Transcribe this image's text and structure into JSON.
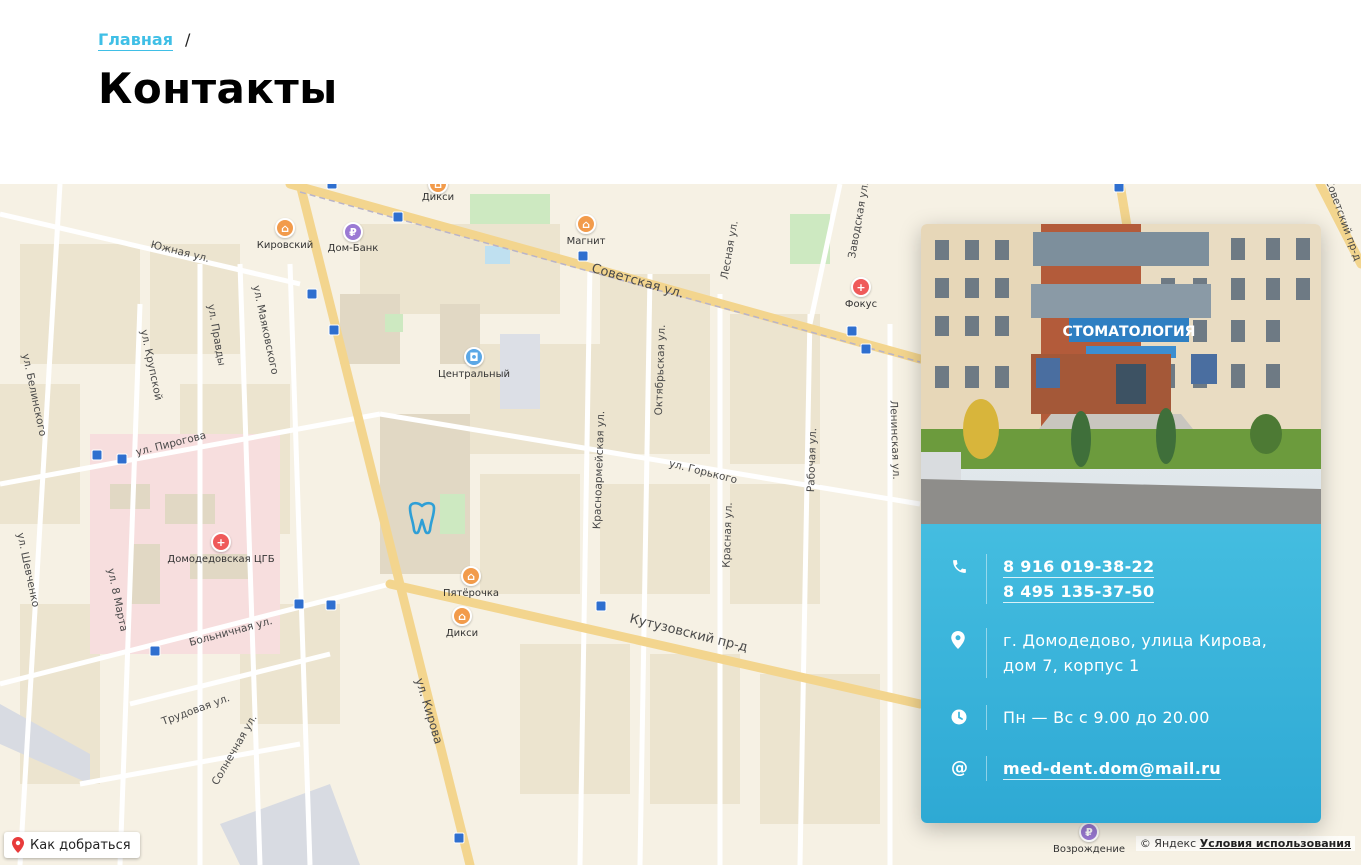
{
  "breadcrumb": {
    "home_label": "Главная",
    "separator": "/"
  },
  "page": {
    "title": "Контакты"
  },
  "map": {
    "streets": [
      "Советская ул.",
      "Кутузовский пр-д",
      "ул. Кирова",
      "ул. Пирогова",
      "ул. Горького",
      "Больничная ул.",
      "Южная ул.",
      "ул. Правды",
      "ул. Маяковского",
      "ул. Крупской",
      "ул. Белинского",
      "ул. Шевченко",
      "ул. 8 Марта",
      "Трудовая ул.",
      "Солнечная ул.",
      "Красноармейская ул.",
      "Октябрьская ул.",
      "Красная ул.",
      "Рабочая ул.",
      "Ленинская ул.",
      "Лесная ул.",
      "Заводская ул.",
      "Советский пр-д"
    ],
    "pois": [
      {
        "name": "Дикси",
        "kind": "shop"
      },
      {
        "name": "Кировский",
        "kind": "shop"
      },
      {
        "name": "Дом-Банк",
        "kind": "bank"
      },
      {
        "name": "Магнит",
        "kind": "shop"
      },
      {
        "name": "Фокус",
        "kind": "hospital"
      },
      {
        "name": "Центральный",
        "kind": "mall"
      },
      {
        "name": "Пятёрочка",
        "kind": "shop"
      },
      {
        "name": "Дикси",
        "kind": "shop"
      },
      {
        "name": "Домодедовская ЦГБ",
        "kind": "hospital"
      },
      {
        "name": "Возрождение",
        "kind": "bank"
      }
    ],
    "route_button": "Как добраться",
    "copyright": "© Яндекс",
    "terms_link": "Условия использования",
    "marker_icon": "tooth-icon"
  },
  "contact": {
    "photo_sign": "СТОМАТОЛОГИЯ",
    "phones": [
      "8 916 019-38-22",
      "8 495 135-37-50"
    ],
    "address_line1": "г. Домодедово, улица Кирова,",
    "address_line2": "дом 7, корпус 1",
    "hours": "Пн — Вс с 9.00 до 20.00",
    "email": "med-dent.dom@mail.ru",
    "icons": {
      "phone": "phone-icon",
      "address": "map-pin-icon",
      "hours": "clock-icon",
      "email": "at-icon"
    },
    "colors": {
      "panel": "#3cb6dd",
      "link": "#3fbfe6"
    }
  }
}
